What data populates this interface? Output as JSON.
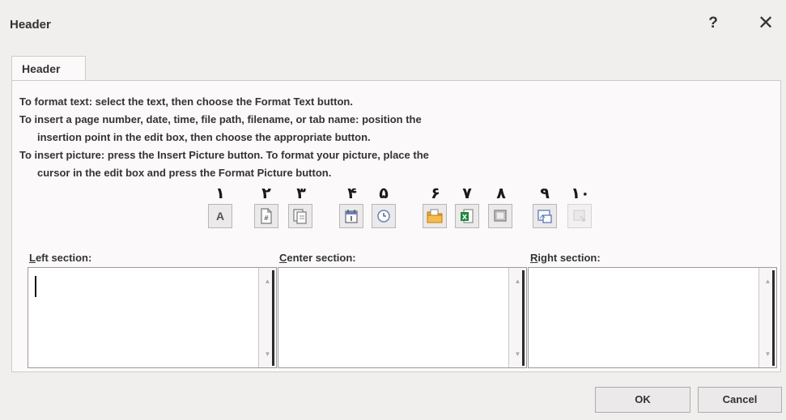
{
  "window": {
    "title": "Header",
    "help_label": "?",
    "close_label": "✕"
  },
  "tab": {
    "label": "Header"
  },
  "instructions": [
    "To format text:  select the text, then choose the Format Text button.",
    "To insert a page number, date, time, file path, filename, or tab name:  position the",
    "insertion point in the edit box, then choose the appropriate button.",
    "To insert picture: press the Insert Picture button.  To format your picture, place the",
    "cursor in the edit box and press the Format Picture button."
  ],
  "toolbar": {
    "numbers": [
      "۱",
      "۲",
      "۳",
      "۴",
      "۵",
      "۶",
      "۷",
      "۸",
      "۹",
      "۱۰"
    ],
    "buttons": [
      {
        "icon": "format-text-icon",
        "enabled": true
      },
      {
        "icon": "insert-page-number-icon",
        "enabled": true
      },
      {
        "icon": "insert-number-of-pages-icon",
        "enabled": true
      },
      {
        "icon": "insert-date-icon",
        "enabled": true
      },
      {
        "icon": "insert-time-icon",
        "enabled": true
      },
      {
        "icon": "insert-file-path-icon",
        "enabled": true
      },
      {
        "icon": "insert-file-name-icon",
        "enabled": true
      },
      {
        "icon": "insert-sheet-name-icon",
        "enabled": true
      },
      {
        "icon": "insert-picture-icon",
        "enabled": true
      },
      {
        "icon": "format-picture-icon",
        "enabled": false
      }
    ],
    "format_text_glyph": "A"
  },
  "sections": {
    "left": {
      "label_first": "L",
      "label_rest": "eft section:",
      "value": ""
    },
    "center": {
      "label_first": "C",
      "label_rest": "enter section:",
      "value": ""
    },
    "right": {
      "label_first": "R",
      "label_rest": "ight section:",
      "value": ""
    }
  },
  "buttons": {
    "ok": "OK",
    "cancel": "Cancel"
  },
  "colors": {
    "dialog_bg": "#f1eeee",
    "panel_bg": "#fbf9f9",
    "file_icon": "#f0a830",
    "sheet_icon": "#1e8a3c"
  }
}
